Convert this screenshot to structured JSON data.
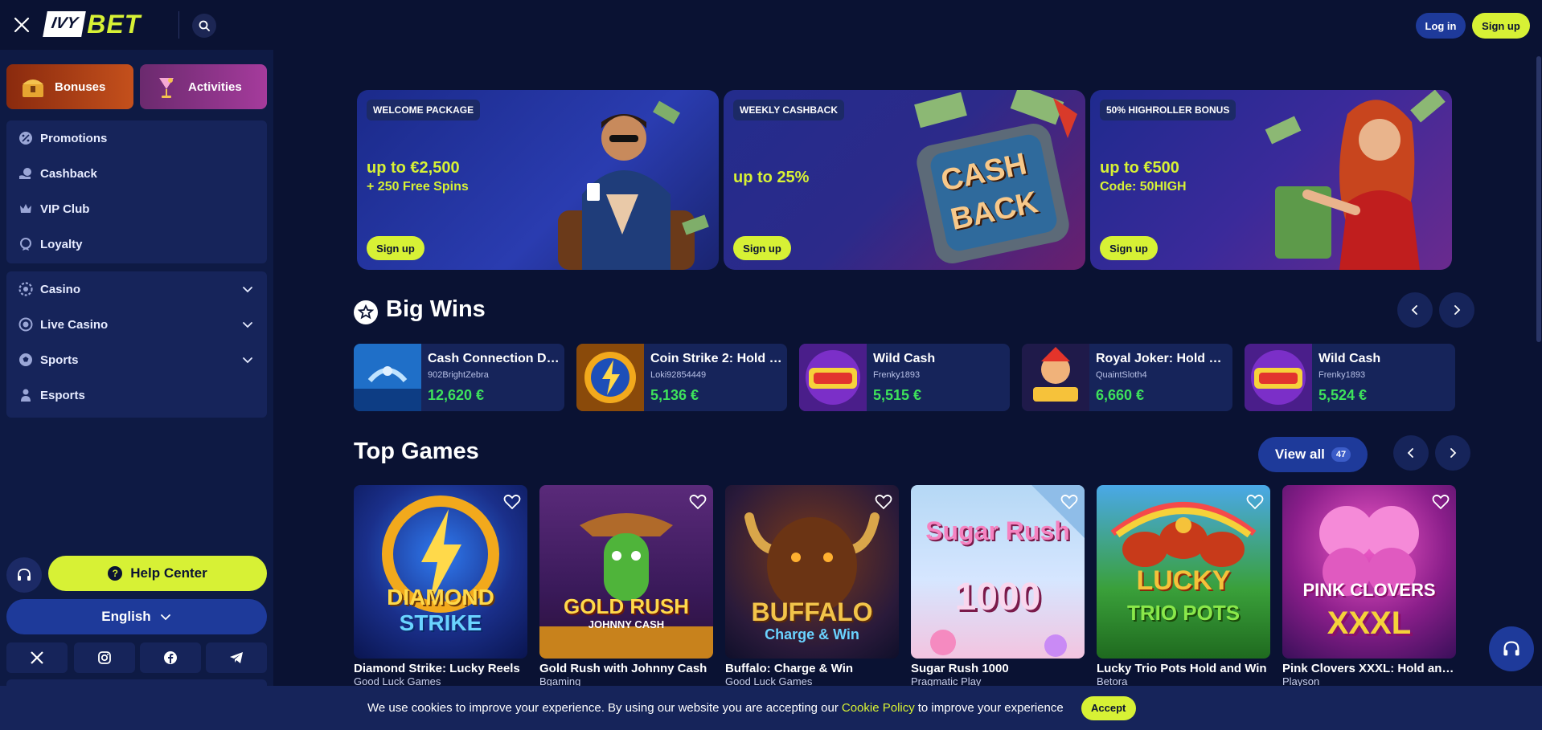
{
  "brand": {
    "logo_left": "IVY",
    "logo_right": "BET"
  },
  "header": {
    "login_label": "Log in",
    "signup_label": "Sign up"
  },
  "sidebar": {
    "tabs": [
      {
        "label": "Bonuses"
      },
      {
        "label": "Activities"
      }
    ],
    "menu_primary": [
      {
        "label": "Promotions",
        "icon": "promotions-icon"
      },
      {
        "label": "Cashback",
        "icon": "cashback-icon"
      },
      {
        "label": "VIP Club",
        "icon": "crown-icon"
      },
      {
        "label": "Loyalty",
        "icon": "loyalty-icon"
      }
    ],
    "menu_secondary": [
      {
        "label": "Casino",
        "icon": "casino-chip-icon",
        "expandable": true
      },
      {
        "label": "Live Casino",
        "icon": "live-icon",
        "expandable": true
      },
      {
        "label": "Sports",
        "icon": "ball-icon",
        "expandable": true
      },
      {
        "label": "Esports",
        "icon": "player-icon",
        "expandable": false
      }
    ],
    "help_label": "Help Center",
    "language": "English",
    "socials": [
      "x-icon",
      "instagram-icon",
      "facebook-icon",
      "telegram-icon"
    ]
  },
  "promos": [
    {
      "tag": "WELCOME PACKAGE",
      "headline": "up to €2,500",
      "subline": "+ 250 Free Spins",
      "button": "Sign up"
    },
    {
      "tag": "WEEKLY CASHBACK",
      "headline": "up to 25%",
      "subline": "",
      "button": "Sign up",
      "art_text_1": "CASH",
      "art_text_2": "BACK"
    },
    {
      "tag": "50% HIGHROLLER BONUS",
      "headline": "up to €500",
      "subline": "Code: 50HIGH",
      "button": "Sign up"
    }
  ],
  "big_wins": {
    "title": "Big Wins",
    "items": [
      {
        "game": "Cash Connection Do...",
        "user": "902BrightZebra",
        "amount": "12,620 €"
      },
      {
        "game": "Coin Strike 2: Hold a...",
        "user": "Loki92854449",
        "amount": "5,136 €"
      },
      {
        "game": "Wild Cash",
        "user": "Frenky1893",
        "amount": "5,515 €"
      },
      {
        "game": "Royal Joker: Hold an...",
        "user": "QuaintSloth4",
        "amount": "6,660 €"
      },
      {
        "game": "Wild Cash",
        "user": "Frenky1893",
        "amount": "5,524 €"
      }
    ]
  },
  "top_games": {
    "title": "Top Games",
    "view_all_label": "View all",
    "view_all_count": "47",
    "items": [
      {
        "name": "Diamond Strike: Lucky Reels",
        "provider": "Good Luck Games",
        "art_line1": "DIAMOND",
        "art_line2": "STRIKE"
      },
      {
        "name": "Gold Rush with Johnny Cash",
        "provider": "Bgaming",
        "art_line1": "GOLD RUSH",
        "art_line2": "JOHNNY CASH"
      },
      {
        "name": "Buffalo: Charge & Win",
        "provider": "Good Luck Games",
        "art_line1": "BUFFALO",
        "art_line2": "Charge & Win"
      },
      {
        "name": "Sugar Rush 1000",
        "provider": "Pragmatic Play",
        "art_line1": "Sugar Rush",
        "art_line2": "1000"
      },
      {
        "name": "Lucky Trio Pots Hold and Win",
        "provider": "Betora",
        "art_line1": "LUCKY",
        "art_line2": "TRIO POTS"
      },
      {
        "name": "Pink Clovers XXXL: Hold and...",
        "provider": "Playson",
        "art_line1": "PINK CLOVERS",
        "art_line2": "XXXL"
      }
    ]
  },
  "cookie": {
    "text_before": "We use cookies to improve your experience. By using our website you are accepting our",
    "policy_link": "Cookie Policy",
    "text_after": "to improve your experience",
    "accept_label": "Accept"
  },
  "colors": {
    "accent": "#d7f135",
    "background": "#0a1233",
    "panel": "#16245a",
    "primary": "#1e3a9a",
    "win_green": "#3ee25b"
  }
}
